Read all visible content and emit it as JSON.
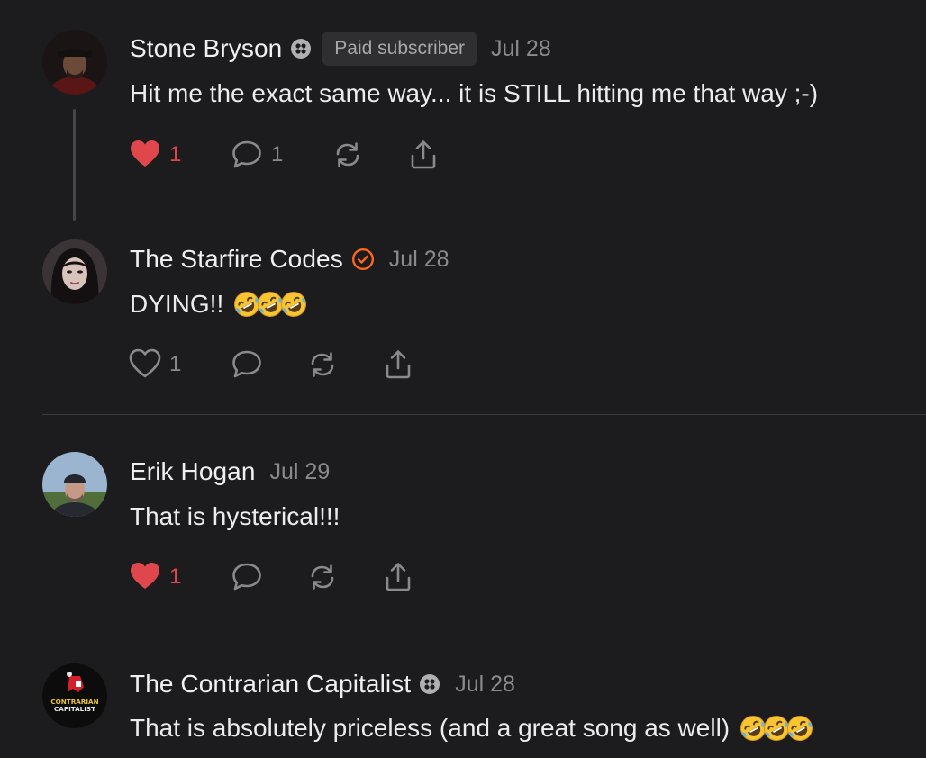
{
  "comments": [
    {
      "author": "Stone Bryson",
      "author_badge_icon": "subscriber-badge-icon",
      "subscriber_badge": "Paid subscriber",
      "date": "Jul 28",
      "text": "Hit me the exact same way... it is STILL hitting me that way ;-)",
      "likes": "1",
      "liked": true,
      "replies": "1"
    },
    {
      "author": "The Starfire Codes",
      "author_badge_icon": "verified-check-icon",
      "date": "Jul 28",
      "text": "DYING!!",
      "emojis": [
        "rofl-emoji",
        "rofl-emoji",
        "rofl-emoji"
      ],
      "likes": "1",
      "liked": false
    },
    {
      "author": "Erik Hogan",
      "date": "Jul 29",
      "text": "That is hysterical!!!",
      "likes": "1",
      "liked": true
    },
    {
      "author": "The Contrarian Capitalist",
      "author_badge_icon": "subscriber-badge-icon",
      "date": "Jul 28",
      "text": "That is absolutely priceless (and a great song as well)",
      "emojis": [
        "rofl-emoji",
        "rofl-emoji",
        "rofl-emoji"
      ],
      "avatar_text": [
        "CONTRARIAN",
        "CAPITALIST"
      ]
    }
  ],
  "colors": {
    "background": "#1c1c1e",
    "like_red": "#e0474c",
    "verified_orange": "#ff6719",
    "muted": "#8a8a8e"
  }
}
